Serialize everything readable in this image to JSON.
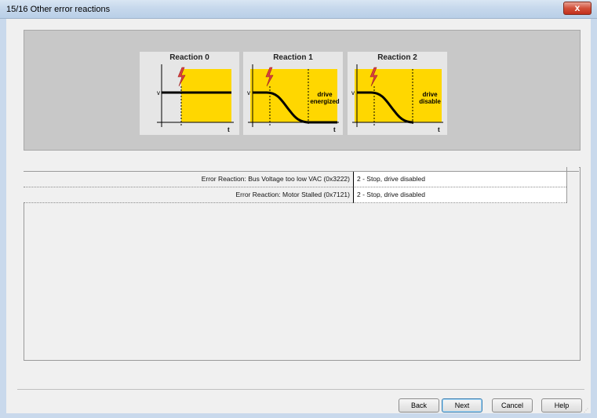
{
  "window": {
    "title": "15/16 Other error reactions",
    "close_label": "x"
  },
  "diagram": {
    "reactions": [
      {
        "title": "Reaction 0",
        "label": "",
        "v_label": "v",
        "t_label": "t"
      },
      {
        "title": "Reaction 1",
        "label": "drive energized",
        "label_line1": "drive",
        "label_line2": "energized",
        "v_label": "v",
        "t_label": "t"
      },
      {
        "title": "Reaction 2",
        "label": "drive disable",
        "label_line1": "drive",
        "label_line2": "disable",
        "v_label": "v",
        "t_label": "t"
      }
    ],
    "colors": {
      "panel": "#c8c8c8",
      "plot_fill": "#ffd700",
      "curve": "#000000",
      "bolt": "#d94040"
    }
  },
  "table": {
    "rows": [
      {
        "label": "Error Reaction: Bus Voltage too low VAC (0x3222)",
        "value": "2 - Stop, drive disabled"
      },
      {
        "label": "Error Reaction: Motor Stalled (0x7121)",
        "value": "2 - Stop, drive disabled"
      }
    ]
  },
  "footer": {
    "back": "Back",
    "next": "Next",
    "cancel": "Cancel",
    "help": "Help"
  }
}
